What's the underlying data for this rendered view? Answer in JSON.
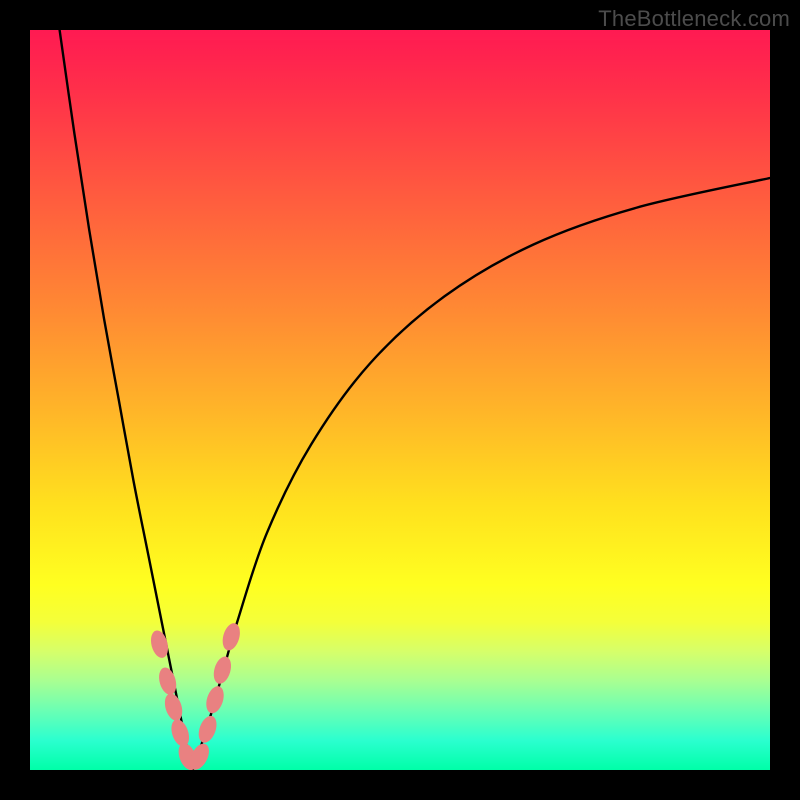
{
  "watermark": {
    "text": "TheBottleneck.com"
  },
  "chart_data": {
    "type": "line",
    "title": "",
    "xlabel": "",
    "ylabel": "",
    "xlim": [
      0,
      100
    ],
    "ylim": [
      0,
      100
    ],
    "notch_x": 22,
    "series": [
      {
        "name": "left-branch",
        "x": [
          4,
          6,
          8,
          10,
          12,
          14,
          16,
          18,
          20,
          21,
          22
        ],
        "y": [
          100,
          86,
          73,
          61,
          50,
          39,
          29,
          19,
          9,
          4,
          0
        ]
      },
      {
        "name": "right-branch",
        "x": [
          22,
          24,
          26,
          28,
          32,
          38,
          46,
          56,
          68,
          82,
          100
        ],
        "y": [
          0,
          6,
          13,
          20,
          32,
          44,
          55,
          64,
          71,
          76,
          80
        ]
      }
    ],
    "markers": {
      "name": "highlight-points",
      "color": "#e98181",
      "points": [
        {
          "x": 17.5,
          "y": 17
        },
        {
          "x": 18.6,
          "y": 12
        },
        {
          "x": 19.4,
          "y": 8.5
        },
        {
          "x": 20.3,
          "y": 5
        },
        {
          "x": 21.3,
          "y": 1.8
        },
        {
          "x": 22.9,
          "y": 1.8
        },
        {
          "x": 24.0,
          "y": 5.5
        },
        {
          "x": 25.0,
          "y": 9.5
        },
        {
          "x": 26.0,
          "y": 13.5
        },
        {
          "x": 27.2,
          "y": 18
        }
      ]
    }
  }
}
